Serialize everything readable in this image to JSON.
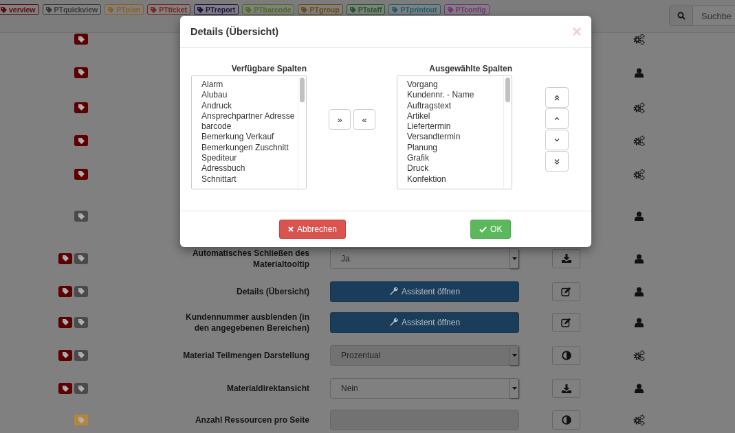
{
  "header": {
    "tags": [
      {
        "label": "verview",
        "color": "#5a0c0c"
      },
      {
        "label": "PTquickview",
        "color": "#383838"
      },
      {
        "label": "PTplan",
        "color": "#8a6020"
      },
      {
        "label": "PTticket",
        "color": "#7a2422"
      },
      {
        "label": "PTreport",
        "color": "#24104a"
      },
      {
        "label": "PTbarcode",
        "color": "#4f6d22"
      },
      {
        "label": "PTgroup",
        "color": "#6e4a14"
      },
      {
        "label": "PTstaff",
        "color": "#235a2a"
      },
      {
        "label": "PTprintout",
        "color": "#215e70"
      },
      {
        "label": "PTconfig",
        "color": "#783478"
      }
    ],
    "search": {
      "placeholder": "Suchbe"
    }
  },
  "rows": [
    {
      "tags": [
        {
          "color": "#5c0000"
        }
      ],
      "icon": {
        "kind": "gears"
      }
    },
    {
      "tags": [
        {
          "color": "#5c0000"
        }
      ],
      "icon": {
        "kind": "user"
      }
    },
    {
      "tags": [
        {
          "color": "#5c0000"
        }
      ],
      "icon": {
        "kind": "gears"
      }
    },
    {
      "tags": [
        {
          "color": "#5c0000"
        }
      ],
      "icon": {
        "kind": "gears"
      }
    },
    {
      "tags": [
        {
          "color": "#5c0000"
        }
      ],
      "icon": {
        "kind": "gears"
      }
    },
    {
      "tags": [
        {
          "color": "#4a4a4a"
        }
      ],
      "icon": {
        "kind": "user"
      }
    },
    {
      "tags": [
        {
          "color": "#5c0000"
        },
        {
          "color": "#4a4a4a"
        }
      ],
      "label": "Automatisches Schließen des Materialtooltip",
      "control": {
        "kind": "select",
        "value": "Ja",
        "disabled": false
      },
      "action": {
        "kind": "download"
      },
      "icon": {
        "kind": "user"
      }
    },
    {
      "tags": [
        {
          "color": "#5c0000"
        },
        {
          "color": "#4a4a4a"
        }
      ],
      "label": "Details (Übersicht)",
      "control": {
        "kind": "wizard",
        "label": "Assistent öffnen"
      },
      "action": {
        "kind": "edit"
      },
      "icon": {
        "kind": "user"
      }
    },
    {
      "tags": [
        {
          "color": "#5c0000"
        },
        {
          "color": "#4a4a4a"
        }
      ],
      "label": "Kundennummer ausblenden (in den angegebenen Bereichen)",
      "control": {
        "kind": "wizard",
        "label": "Assistent öffnen"
      },
      "action": {
        "kind": "edit"
      },
      "icon": {
        "kind": "user"
      }
    },
    {
      "tags": [
        {
          "color": "#5c0000"
        },
        {
          "color": "#4a4a4a"
        }
      ],
      "label": "Material Teilmengen Darstellung",
      "control": {
        "kind": "select",
        "value": "Prozentual",
        "disabled": true
      },
      "action": {
        "kind": "contrast"
      },
      "icon": {
        "kind": "gears"
      }
    },
    {
      "tags": [
        {
          "color": "#5c0000"
        },
        {
          "color": "#4a4a4a"
        }
      ],
      "label": "Materialdirektansicht",
      "control": {
        "kind": "select",
        "value": "Nein",
        "disabled": false
      },
      "action": {
        "kind": "download"
      },
      "icon": {
        "kind": "user"
      }
    },
    {
      "tags": [
        {
          "color": "#b5863a"
        }
      ],
      "label": "Anzahl Ressourcen pro Seite",
      "control": {
        "kind": "input",
        "disabled": true
      },
      "action": {
        "kind": "contrast"
      },
      "icon": {
        "kind": "gears"
      }
    }
  ],
  "modal": {
    "title": "Details (Übersicht)",
    "available": {
      "title": "Verfügbare Spalten",
      "items": [
        "Alarm",
        "Alubau",
        "Andruck",
        "Ansprechpartner Adresse",
        "barcode",
        "Bemerkung Verkauf",
        "Bemerkungen Zuschnitt",
        "Spediteur",
        "Adressbuch",
        "Schnittart"
      ]
    },
    "selected": {
      "title": "Ausgewählte Spalten",
      "items": [
        "Vorgang",
        "Kundennr. - Name",
        "Auftragstext",
        "Artikel",
        "Liefertermin",
        "Versandtermin",
        "Planung",
        "Grafik",
        "Druck",
        "Konfektion"
      ]
    },
    "transfer_buttons": [
      "»",
      "«"
    ],
    "cancel": "Abbrechen",
    "ok": "OK"
  }
}
